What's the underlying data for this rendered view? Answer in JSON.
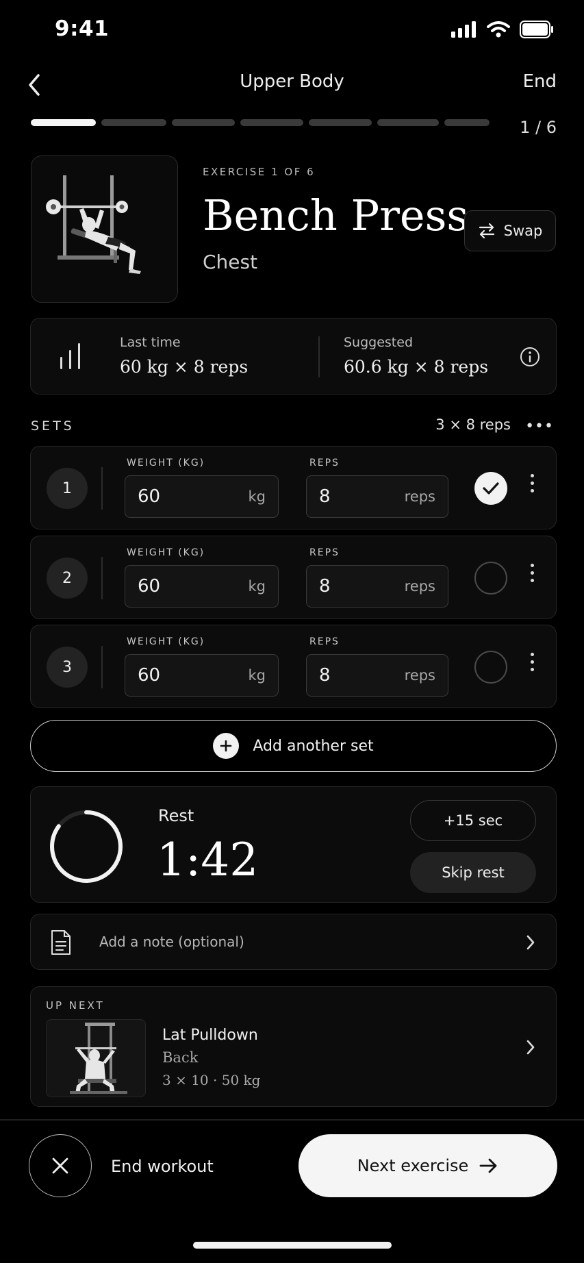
{
  "status_bar": {
    "time": "9:41"
  },
  "header": {
    "title": "Upper Body",
    "end_label": "End"
  },
  "progress": {
    "current": 1,
    "total": 6,
    "label": "1 / 6"
  },
  "exercise": {
    "label": "EXERCISE 1 OF 6",
    "name": "Bench Press",
    "muscle": "Chest",
    "swap_label": "Swap"
  },
  "stats": {
    "last_label": "Last time",
    "last_value": "60 kg × 8 reps",
    "suggested_label": "Suggested",
    "suggested_value": "60.6 kg × 8 reps"
  },
  "sets_section": {
    "label": "SETS",
    "summary": "3 × 8 reps",
    "more": "•••",
    "weight_label": "WEIGHT (KG)",
    "reps_label": "REPS",
    "weight_unit": "kg",
    "reps_unit": "reps",
    "sets": [
      {
        "number": "1",
        "weight": "60",
        "reps": "8",
        "done": true
      },
      {
        "number": "2",
        "weight": "60",
        "reps": "8",
        "done": false
      },
      {
        "number": "3",
        "weight": "60",
        "reps": "8",
        "done": false
      }
    ],
    "add_label": "Add another set"
  },
  "rest": {
    "label": "Rest",
    "value": "1:42",
    "add_time_label": "+15 sec",
    "skip_label": "Skip rest",
    "progress_fraction": 0.85
  },
  "note": {
    "placeholder": "Add a note (optional)"
  },
  "up_next": {
    "label": "UP NEXT",
    "name": "Lat Pulldown",
    "muscle": "Back",
    "detail": "3 × 10 · 50 kg"
  },
  "footer": {
    "end_label": "End workout",
    "next_label": "Next exercise"
  },
  "icons": {
    "back": "chevron-left-icon",
    "swap": "swap-arrows-icon",
    "stats": "bar-chart-icon",
    "info": "info-icon",
    "note": "document-icon",
    "chevron": "chevron-right-icon",
    "close": "close-icon",
    "arrow": "arrow-right-icon"
  },
  "colors": {
    "background": "#000000",
    "card": "#0c0c0c",
    "accent": "#f5f5f5"
  }
}
